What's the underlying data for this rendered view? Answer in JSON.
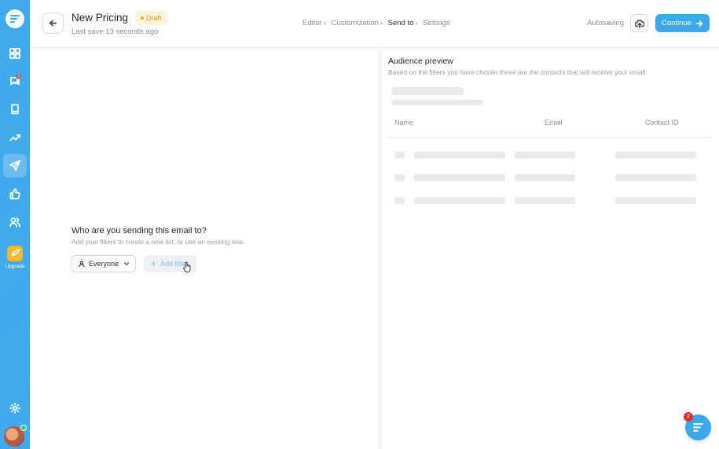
{
  "header": {
    "title": "New Pricing",
    "status_badge": "Draft",
    "last_save": "Last save 13 seconds ago",
    "breadcrumbs": [
      {
        "label": "Editor"
      },
      {
        "label": "Customization"
      },
      {
        "label": "Send to"
      },
      {
        "label": "Settings"
      }
    ],
    "autosave_text": "Autosaving",
    "continue_label": "Continue"
  },
  "sidebar": {
    "notification_count": "1",
    "upgrade_label": "Upgrade",
    "items": [
      {
        "icon": "grid-icon"
      },
      {
        "icon": "chat-icon"
      },
      {
        "icon": "book-icon"
      },
      {
        "icon": "trend-icon"
      },
      {
        "icon": "send-icon",
        "active": true
      },
      {
        "icon": "thumbs-up-icon"
      },
      {
        "icon": "users-icon"
      },
      {
        "icon": "gear-icon"
      }
    ]
  },
  "audience": {
    "question": "Who are you sending this email to?",
    "subtitle": "Add your filters to create a new list, or use an existing one.",
    "selected": "Everyone",
    "add_filter_label": "Add filter"
  },
  "preview": {
    "title": "Audience preview",
    "subtitle": "Based on the filters you have chosen these are the contacts that will receive your email.",
    "columns": [
      "Name",
      "Email",
      "Contact ID"
    ]
  },
  "chat": {
    "badge_count": "2"
  },
  "colors": {
    "accent": "#3ba8ec",
    "draft_text": "#e3a21a",
    "draft_bg": "#fdf3dd",
    "notification": "#e02f2f",
    "upgrade": "#f5b82e"
  }
}
